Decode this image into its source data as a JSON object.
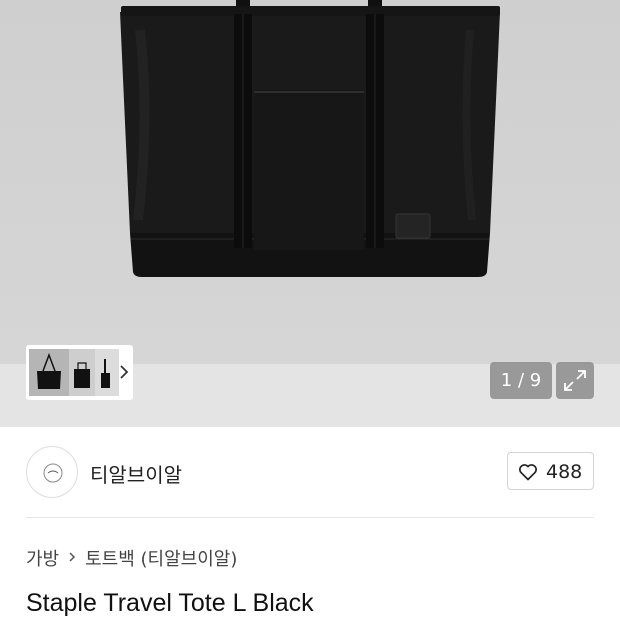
{
  "gallery": {
    "counter": "1 / 9",
    "current_image": 1,
    "total_images": 9,
    "product_color": "#111111",
    "thumbnail_count": 3,
    "icons": {
      "next": "chevron-right-icon",
      "expand": "expand-icon"
    }
  },
  "seller": {
    "name": "티알브이알",
    "likes": "488",
    "icons": {
      "like": "heart-icon"
    }
  },
  "breadcrumb": {
    "items": [
      "가방",
      "토트백 (티알브이알)"
    ],
    "separator_icon": "chevron-right-icon"
  },
  "product": {
    "title": "Staple Travel Tote L Black"
  }
}
